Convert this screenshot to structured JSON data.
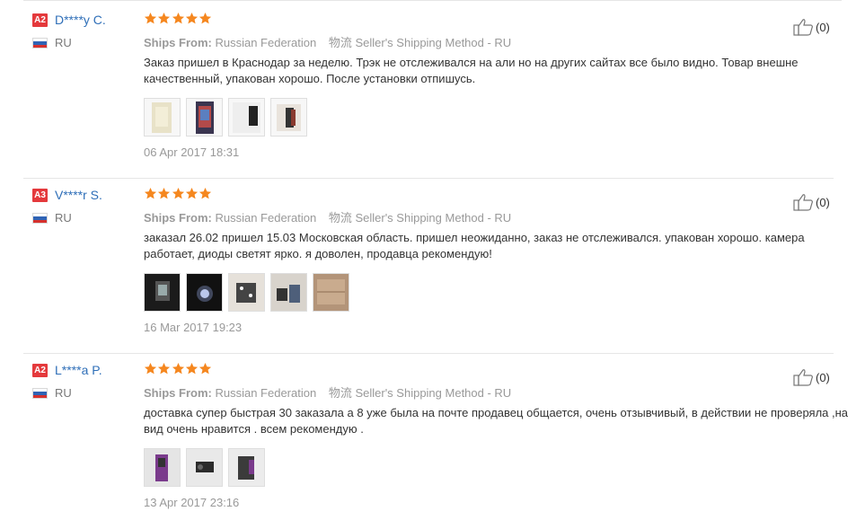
{
  "labels": {
    "ships_from": "Ships From:",
    "logistics_icon": "物流"
  },
  "icons": {
    "star": "star-icon",
    "thumb": "thumbs-up-icon",
    "flag": "russia-flag-icon"
  },
  "colors": {
    "star": "#f5871f",
    "badge": "#e4393c",
    "name": "#2f6fb8"
  },
  "reviews": [
    {
      "level": "A2",
      "name": "D****y C.",
      "country": "RU",
      "rating": 5,
      "ships_from": "Russian Federation",
      "shipping_method": "Seller's Shipping Method - RU",
      "feedback": "Заказ пришел в Краснодар за неделю. Трэк не отслеживался на али но на других сайтах все было видно. Товар внешне качественный, упакован хорошо. После установки отпишусь.",
      "photos": [
        "photo-1",
        "photo-2",
        "photo-3",
        "photo-4"
      ],
      "date": "06 Apr 2017 18:31",
      "helpful": "(0)"
    },
    {
      "level": "A3",
      "name": "V****r S.",
      "country": "RU",
      "rating": 5,
      "ships_from": "Russian Federation",
      "shipping_method": "Seller's Shipping Method - RU",
      "feedback": "заказал 26.02 пришел 15.03 Московская область. пришел неожиданно, заказ не отслеживался. упакован хорошо. камера работает, диоды светят ярко. я доволен, продавца рекомендую!",
      "photos": [
        "photo-1",
        "photo-2",
        "photo-3",
        "photo-4",
        "photo-5"
      ],
      "date": "16 Mar 2017 19:23",
      "helpful": "(0)"
    },
    {
      "level": "A2",
      "name": "L****a P.",
      "country": "RU",
      "rating": 5,
      "ships_from": "Russian Federation",
      "shipping_method": "Seller's Shipping Method - RU",
      "feedback": "доставка супер быстрая 30 заказала а 8 уже была на почте продавец общается, очень отзывчивый, в действии не проверяла ,на вид очень нравится . всем рекомендую .",
      "photos": [
        "photo-1",
        "photo-2",
        "photo-3"
      ],
      "date": "13 Apr 2017 23:16",
      "helpful": "(0)"
    }
  ]
}
